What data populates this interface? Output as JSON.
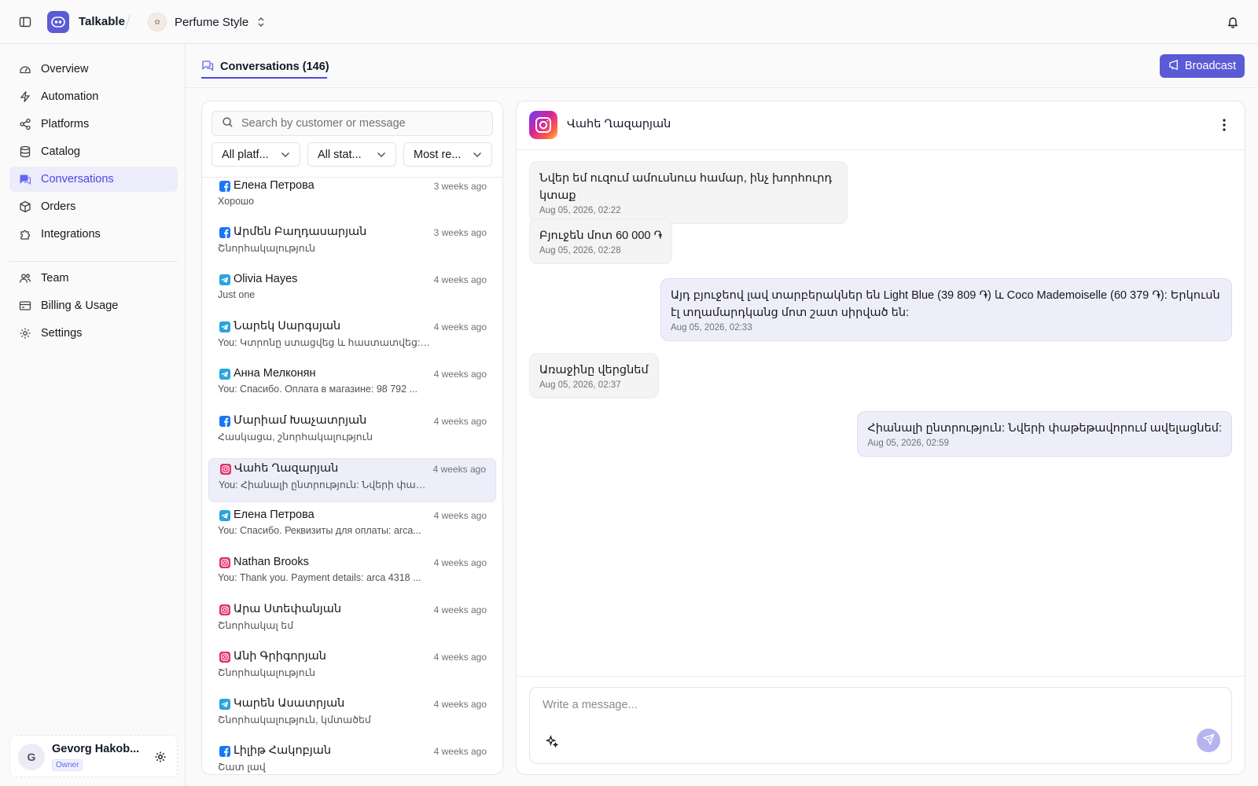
{
  "app": {
    "name": "Talkable",
    "store_name": "Perfume Style"
  },
  "colors": {
    "accent": "#5b5bd6",
    "facebook": "#1877f2",
    "telegram": "#2aa3dd",
    "instagram": "#e1306c"
  },
  "sidebar": {
    "items": [
      {
        "label": "Overview",
        "icon": "gauge-icon"
      },
      {
        "label": "Automation",
        "icon": "lightning-icon"
      },
      {
        "label": "Platforms",
        "icon": "share-icon"
      },
      {
        "label": "Catalog",
        "icon": "database-icon"
      },
      {
        "label": "Conversations",
        "icon": "chat-icon",
        "active": true
      },
      {
        "label": "Orders",
        "icon": "box-icon"
      },
      {
        "label": "Integrations",
        "icon": "puzzle-icon"
      },
      {
        "label": "Team",
        "icon": "users-icon"
      },
      {
        "label": "Billing & Usage",
        "icon": "credit-card-icon"
      },
      {
        "label": "Settings",
        "icon": "gear-icon"
      }
    ],
    "user": {
      "initial": "G",
      "name": "Gevorg Hakob...",
      "role": "Owner"
    }
  },
  "main": {
    "tab_label": "Conversations (146)",
    "broadcast_label": "Broadcast"
  },
  "list": {
    "search_placeholder": "Search by customer or message",
    "filters": [
      "All platf...",
      "All stat...",
      "Most re..."
    ],
    "conversations": [
      {
        "platform": "facebook",
        "name": "Елена Петрова",
        "time": "3 weeks ago",
        "preview": "Хорошо"
      },
      {
        "platform": "facebook",
        "name": "Արմեն Բաղդասարյան",
        "time": "3 weeks ago",
        "preview": "Շնորհակալություն"
      },
      {
        "platform": "telegram",
        "name": "Olivia Hayes",
        "time": "4 weeks ago",
        "preview": "Just one"
      },
      {
        "platform": "telegram",
        "name": "Նարեկ Սարգսյան",
        "time": "4 weeks ago",
        "preview": "You: Կտրոնը ստացվեց և հաստատվեց: Շ..."
      },
      {
        "platform": "telegram",
        "name": "Анна Мелконян",
        "time": "4 weeks ago",
        "preview": "You: Спасибо. Оплата в магазине: 98 792 ..."
      },
      {
        "platform": "facebook",
        "name": "Մարիամ Խաչատրյան",
        "time": "4 weeks ago",
        "preview": "Հասկացա, շնորհակալություն"
      },
      {
        "platform": "instagram",
        "name": "Վահե Ղազարյան",
        "time": "4 weeks ago",
        "preview": "You: Հիանալի ընտրություն: Նվերի փաթեթ...",
        "selected": true
      },
      {
        "platform": "telegram",
        "name": "Елена Петрова",
        "time": "4 weeks ago",
        "preview": "You: Спасибо. Реквизиты для оплаты: arca..."
      },
      {
        "platform": "instagram",
        "name": "Nathan Brooks",
        "time": "4 weeks ago",
        "preview": "You: Thank you. Payment details: arca 4318 ..."
      },
      {
        "platform": "instagram",
        "name": "Արա Ստեփանյան",
        "time": "4 weeks ago",
        "preview": "Շնորհակալ եմ"
      },
      {
        "platform": "instagram",
        "name": "Անի Գրիգորյան",
        "time": "4 weeks ago",
        "preview": "Շնորհակալություն"
      },
      {
        "platform": "telegram",
        "name": "Կարեն Ասատրյան",
        "time": "4 weeks ago",
        "preview": "Շնորհակալություն, կմտածեմ"
      },
      {
        "platform": "facebook",
        "name": "Լիլիթ Հակոբյան",
        "time": "4 weeks ago",
        "preview": "Շատ լավ"
      }
    ]
  },
  "chat": {
    "contact_name": "Վահե Ղազարյան",
    "platform": "instagram",
    "messages": [
      {
        "dir": "in",
        "text": "Նվեր եմ ուզում ամուսնուս համար, ինչ խորհուրդ կտաք",
        "time": "Aug 05, 2026, 02:22"
      },
      {
        "dir": "in",
        "text": "Բյուջեն մոտ 60 000 ֏",
        "time": "Aug 05, 2026, 02:28"
      },
      {
        "dir": "out",
        "text": "Այդ բյուջեով լավ տարբերակներ են Light Blue (39 809 ֏) և Coco Mademoiselle (60 379 ֏): Երկուսն էլ տղամարդկանց մոտ շատ սիրված են:",
        "time": "Aug 05, 2026, 02:33"
      },
      {
        "dir": "in",
        "text": "Առաջինը վերցնեմ",
        "time": "Aug 05, 2026, 02:37"
      },
      {
        "dir": "out",
        "text": "Հիանալի ընտրություն: Նվերի փաթեթավորում ավելացնեմ:",
        "time": "Aug 05, 2026, 02:59"
      }
    ],
    "composer_placeholder": "Write a message..."
  }
}
